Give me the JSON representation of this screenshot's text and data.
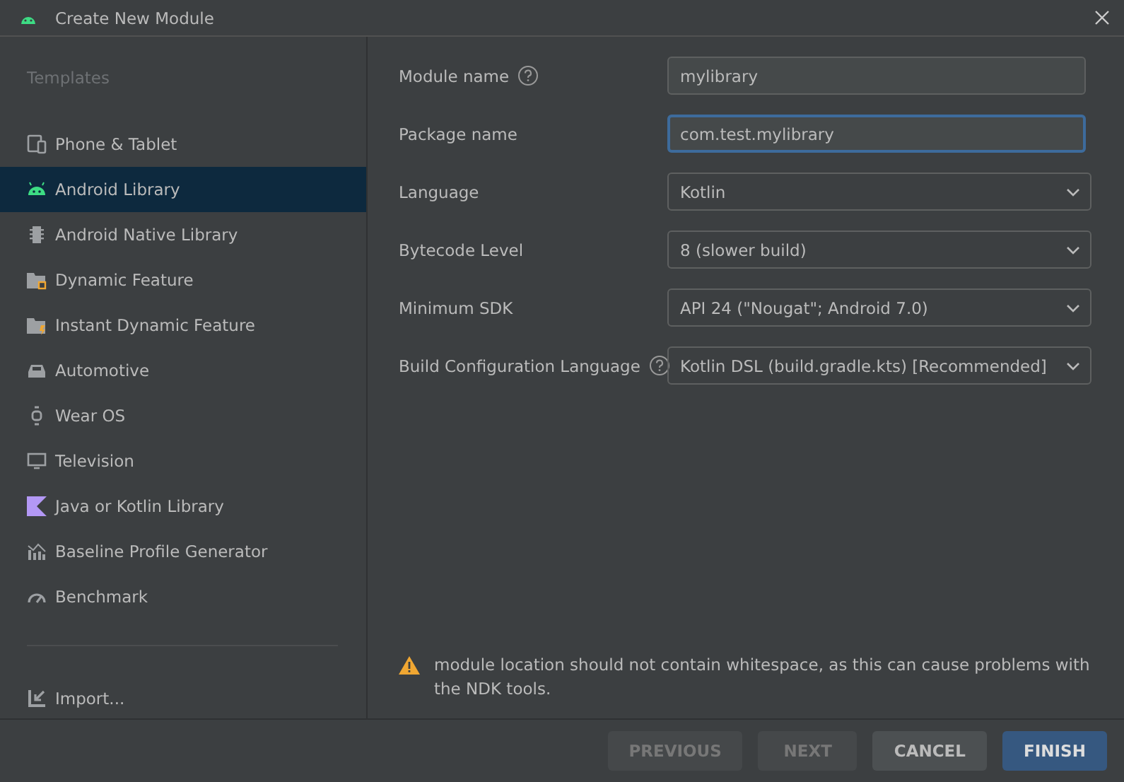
{
  "window": {
    "title": "Create New Module"
  },
  "sidebar": {
    "heading": "Templates",
    "items": [
      {
        "label": "Phone & Tablet",
        "selected": false
      },
      {
        "label": "Android Library",
        "selected": true
      },
      {
        "label": "Android Native Library",
        "selected": false
      },
      {
        "label": "Dynamic Feature",
        "selected": false
      },
      {
        "label": "Instant Dynamic Feature",
        "selected": false
      },
      {
        "label": "Automotive",
        "selected": false
      },
      {
        "label": "Wear OS",
        "selected": false
      },
      {
        "label": "Television",
        "selected": false
      },
      {
        "label": "Java or Kotlin Library",
        "selected": false
      },
      {
        "label": "Baseline Profile Generator",
        "selected": false
      },
      {
        "label": "Benchmark",
        "selected": false
      }
    ],
    "import": {
      "label": "Import..."
    }
  },
  "form": {
    "fields": [
      {
        "kind": "text",
        "label": "Module name",
        "help": true,
        "value": "mylibrary",
        "focused": false
      },
      {
        "kind": "text",
        "label": "Package name",
        "help": false,
        "value": "com.test.mylibrary",
        "focused": true
      },
      {
        "kind": "dropdown",
        "label": "Language",
        "help": false,
        "value": "Kotlin"
      },
      {
        "kind": "dropdown",
        "label": "Bytecode Level",
        "help": false,
        "value": "8 (slower build)"
      },
      {
        "kind": "dropdown",
        "label": "Minimum SDK",
        "help": false,
        "value": "API 24 (\"Nougat\"; Android 7.0)"
      },
      {
        "kind": "dropdown",
        "label": "Build Configuration Language",
        "help": true,
        "value": "Kotlin DSL (build.gradle.kts) [Recommended]"
      }
    ],
    "warning": "module location should not contain whitespace, as this can cause problems with the NDK tools."
  },
  "buttons": [
    {
      "label": "PREVIOUS",
      "disabled": true,
      "primary": false
    },
    {
      "label": "NEXT",
      "disabled": true,
      "primary": false
    },
    {
      "label": "CANCEL",
      "disabled": false,
      "primary": false
    },
    {
      "label": "FINISH",
      "disabled": false,
      "primary": true
    }
  ]
}
